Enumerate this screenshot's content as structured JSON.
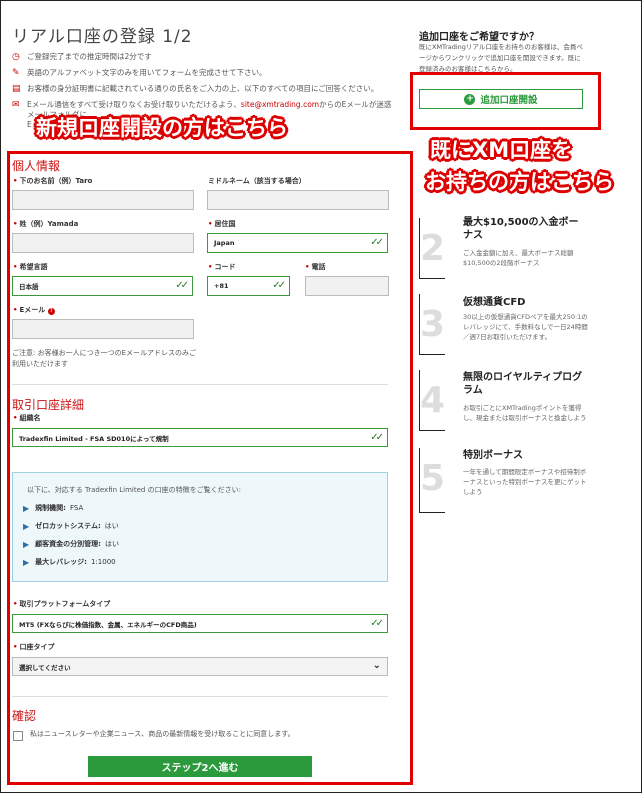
{
  "page": {
    "title": "リアル口座の登録 1/2"
  },
  "notes": [
    {
      "icon": "clock-icon",
      "text": "ご登録完了までの推定時間は2分です"
    },
    {
      "icon": "pencil-icon",
      "text": "英語のアルファベット文字のみを用いてフォームを完成させて下さい。"
    },
    {
      "icon": "document-icon",
      "text": "お客様の身分証明書に記載されている通りの氏名をご入力の上、以下のすべての項目にご回答ください。"
    },
    {
      "icon": "mail-icon",
      "text_before": "Eメール通信をすべて受け取りなくお受け取りいただけるよう、",
      "link": "site@xmtrading.com",
      "text_after": "からのEメールが迷惑メールフォルダに…",
      "tail": "Eメール…"
    }
  ],
  "overlays": {
    "new_account": "新規口座開設の方はこちら",
    "existing_line1": "既にXM口座を",
    "existing_line2": "お持ちの方はこちら"
  },
  "personal": {
    "section_title": "個人情報",
    "first_name_label": "下のお名前（例）Taro",
    "middle_name_label": "ミドルネーム（該当する場合）",
    "last_name_label": "姓（例）Yamada",
    "country_label": "居住国",
    "country_value": "Japan",
    "language_label": "希望言語",
    "language_value": "日本語",
    "code_label": "コード",
    "code_value": "+81",
    "phone_label": "電話",
    "email_label": "Eメール",
    "email_note": "ご注意: お客様お一人につき一つのEメールアドレスのみご利用いただけます"
  },
  "account": {
    "section_title": "取引口座詳細",
    "entity_label": "組織名",
    "entity_value": "Tradexfin Limited - FSA SD010によって規制",
    "info_title": "以下に、対応する Tradexfin Limited の口座の特徴をご覧ください:",
    "info_items": [
      {
        "key": "規制機関:",
        "value": "FSA"
      },
      {
        "key": "ゼロカットシステム:",
        "value": "はい"
      },
      {
        "key": "顧客資金の分別管理:",
        "value": "はい"
      },
      {
        "key": "最大レバレッジ:",
        "value": "1:1000"
      }
    ],
    "platform_label": "取引プラットフォームタイプ",
    "platform_value": "MT5 (FXならびに株価指数、金属、エネルギーのCFD商品)",
    "type_label": "口座タイプ",
    "type_value": "選択してください"
  },
  "confirm": {
    "section_title": "確認",
    "newsletter_text": "私はニュースレターや企業ニュース、商品の最新情報を受け取ることに同意します。",
    "submit_label": "ステップ2へ進む"
  },
  "sidebar": {
    "title": "追加口座をご希望ですか？",
    "text": "既にXMTradingリアル口座をお持ちのお客様は、会員ページからワンクリックで追加口座を開設できます。既に登録済みのお客様はこちらから。",
    "add_button": "追加口座開設",
    "benefits": [
      {
        "num": "2",
        "title": "最大$10,500の入金ボーナス",
        "desc": "ご入金金額に加え、最大ボーナス総額$10,500の2段階ボーナス"
      },
      {
        "num": "3",
        "title": "仮想通貨CFD",
        "desc": "30以上の仮想通貨CFDペアを最大250:1のレバレッジにて、手数料なしで一日24時間／週7日お取引いただけます。"
      },
      {
        "num": "4",
        "title": "無限のロイヤルティプログラム",
        "desc": "お取引ごとにXMTradingポイントを獲得し、現金または取引ボーナスと換金しよう"
      },
      {
        "num": "5",
        "title": "特別ボーナス",
        "desc": "一年を通して期間限定ボーナスや招待制ボーナスといった特別ボーナスを更にゲットしよう"
      }
    ]
  },
  "colors": {
    "accent_red": "#e00000",
    "green": "#2b9a3c"
  }
}
